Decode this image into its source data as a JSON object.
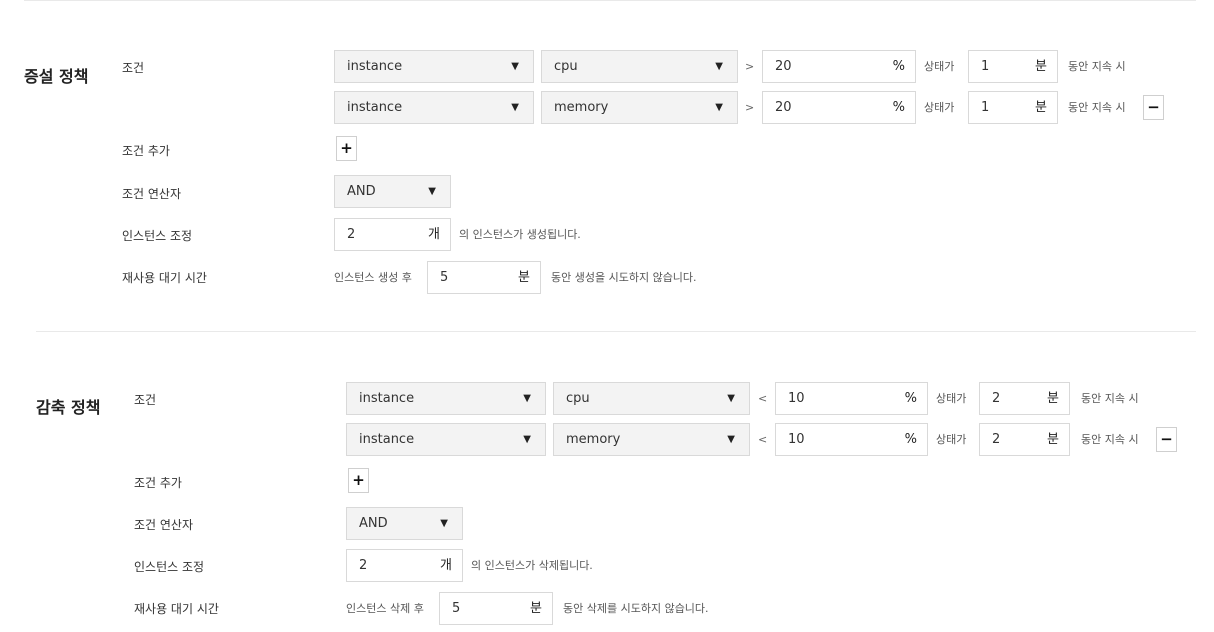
{
  "scale_out": {
    "title": "증설 정책",
    "condition_label": "조건",
    "conditions": [
      {
        "target": "instance",
        "metric": "cpu",
        "operator": ">",
        "threshold": "20",
        "threshold_unit": "%",
        "state_label": "상태가",
        "duration": "1",
        "duration_unit": "분",
        "suffix": "동안 지속 시"
      },
      {
        "target": "instance",
        "metric": "memory",
        "operator": ">",
        "threshold": "20",
        "threshold_unit": "%",
        "state_label": "상태가",
        "duration": "1",
        "duration_unit": "분",
        "suffix": "동안 지속 시",
        "remove_label": "−"
      }
    ],
    "add_condition_label": "조건 추가",
    "add_button_label": "+",
    "operator_label": "조건 연산자",
    "operator_value": "AND",
    "adjust_label": "인스턴스 조정",
    "adjust_count": "2",
    "adjust_unit": "개",
    "adjust_suffix": "의 인스턴스가 생성됩니다.",
    "cooldown_label": "재사용 대기 시간",
    "cooldown_prefix": "인스턴스 생성 후",
    "cooldown_value": "5",
    "cooldown_unit": "분",
    "cooldown_suffix": "동안 생성을 시도하지 않습니다."
  },
  "scale_in": {
    "title": "감축 정책",
    "condition_label": "조건",
    "conditions": [
      {
        "target": "instance",
        "metric": "cpu",
        "operator": "<",
        "threshold": "10",
        "threshold_unit": "%",
        "state_label": "상태가",
        "duration": "2",
        "duration_unit": "분",
        "suffix": "동안 지속 시"
      },
      {
        "target": "instance",
        "metric": "memory",
        "operator": "<",
        "threshold": "10",
        "threshold_unit": "%",
        "state_label": "상태가",
        "duration": "2",
        "duration_unit": "분",
        "suffix": "동안 지속 시",
        "remove_label": "−"
      }
    ],
    "add_condition_label": "조건 추가",
    "add_button_label": "+",
    "operator_label": "조건 연산자",
    "operator_value": "AND",
    "adjust_label": "인스턴스 조정",
    "adjust_count": "2",
    "adjust_unit": "개",
    "adjust_suffix": "의 인스턴스가 삭제됩니다.",
    "cooldown_label": "재사용 대기 시간",
    "cooldown_prefix": "인스턴스 삭제 후",
    "cooldown_value": "5",
    "cooldown_unit": "분",
    "cooldown_suffix": "동안 삭제를 시도하지 않습니다."
  },
  "icons": {
    "dropdown": "caret-down-icon",
    "add": "plus-icon",
    "remove": "minus-icon"
  },
  "colors": {
    "field_bg": "#f3f3f3",
    "border": "#d9d9d9",
    "divider": "#e9e9e9"
  }
}
